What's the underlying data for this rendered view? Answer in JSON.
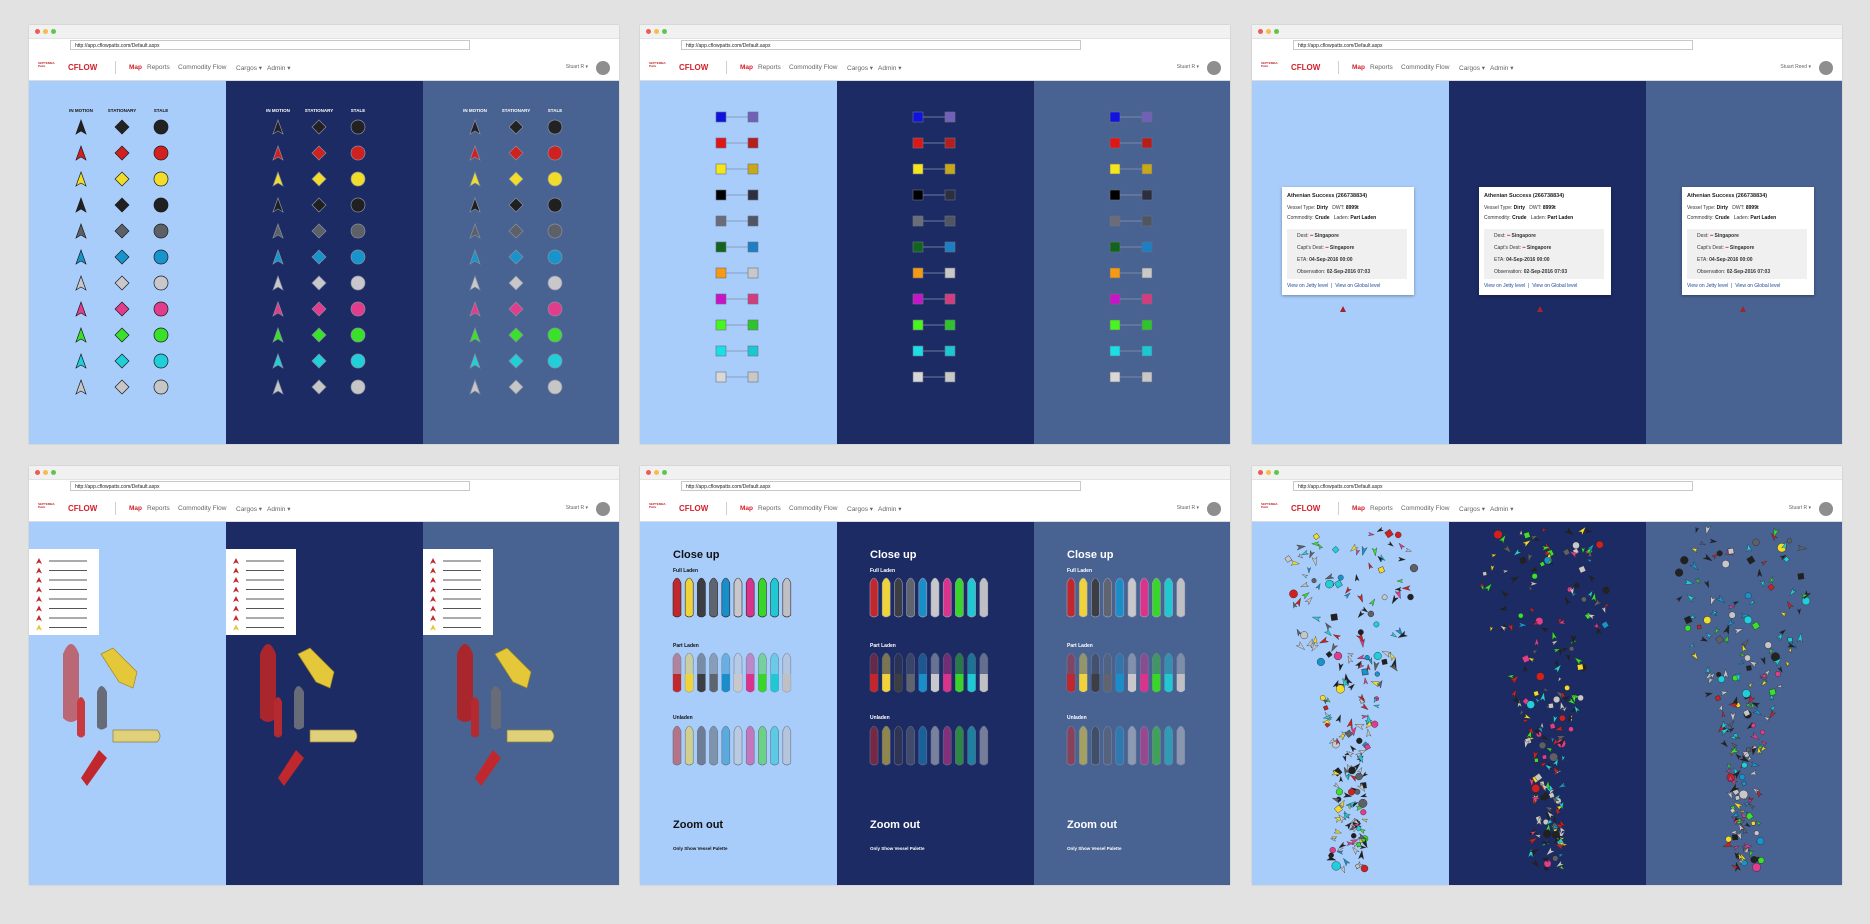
{
  "browser": {
    "url": "http://app.cflowpatts.com/Default.aspx"
  },
  "nav": {
    "brand_small": "SEPTEMBA Patts",
    "brand": "CFLOW",
    "items": [
      "Map",
      "Reports",
      "Commodity Flow",
      "Cargos ▾",
      "Admin ▾"
    ],
    "user": "Stuart R ▾",
    "user_alt": "Stuart Reed ▾"
  },
  "colors": {
    "light_panel": "#a9cdfa",
    "dark_panel": "#1c2b63",
    "mid_panel": "#486392",
    "accent": "#d3212b"
  },
  "palette_headers": [
    "IN MOTION",
    "STATIONARY",
    "STALE"
  ],
  "palette_colors": [
    "#222222",
    "#d0201f",
    "#f2dc2a",
    "#202020",
    "#5e6068",
    "#1794cc",
    "#c8c8cc",
    "#e23d8c",
    "#3ae12b",
    "#20cfd9",
    "#c6c6c6"
  ],
  "pairs": [
    [
      "#0f13e0",
      "#7060b8"
    ],
    [
      "#e01616",
      "#b81d1d"
    ],
    [
      "#f5e51c",
      "#c8a818"
    ],
    [
      "#000000",
      "#2b2f40"
    ],
    [
      "#6a6d78",
      "#505562"
    ],
    [
      "#12641c",
      "#1a7fc4"
    ],
    [
      "#f59a12",
      "#c8c8c8"
    ],
    [
      "#c813c8",
      "#d53c80"
    ],
    [
      "#49f51f",
      "#2ec42b"
    ],
    [
      "#19e0e8",
      "#19c8d2"
    ],
    [
      "#d8d8d8",
      "#c8c8c8"
    ]
  ],
  "popup": {
    "title": "Athenian Success (266738834)",
    "vessel_type_label": "Vessel Type:",
    "vessel_type": "Dirty",
    "dwt_label": "DWT:",
    "dwt": "8999t",
    "commodity_label": "Commodity:",
    "commodity": "Crude",
    "laden_label": "Laden:",
    "laden": "Part Laden",
    "dest_label": "Dest:",
    "dest": "Singapore",
    "capt_dest_label": "Capt's Dest:",
    "capt_dest": "Singapore",
    "eta_label": "ETA:",
    "eta": "04-Sep-2016 00:00",
    "obs_label": "Observation:",
    "obs": "02-Sep-2016 07:03",
    "jetty_link": "View on Jetty level",
    "global_link": "View on Global level"
  },
  "closeup": {
    "title": "Close up",
    "full": "Full Laden",
    "part": "Part Laden",
    "unladen": "Unladen",
    "zoom_out": "Zoom out",
    "palette_note": "Only Show Vessel Palette",
    "ship_colors": [
      "#c0282e",
      "#f0d23a",
      "#3d3d44",
      "#60646e",
      "#1a8ec8",
      "#c8c8cc",
      "#d9338c",
      "#3ad52b",
      "#20c8d2",
      "#c0c0c4"
    ]
  }
}
